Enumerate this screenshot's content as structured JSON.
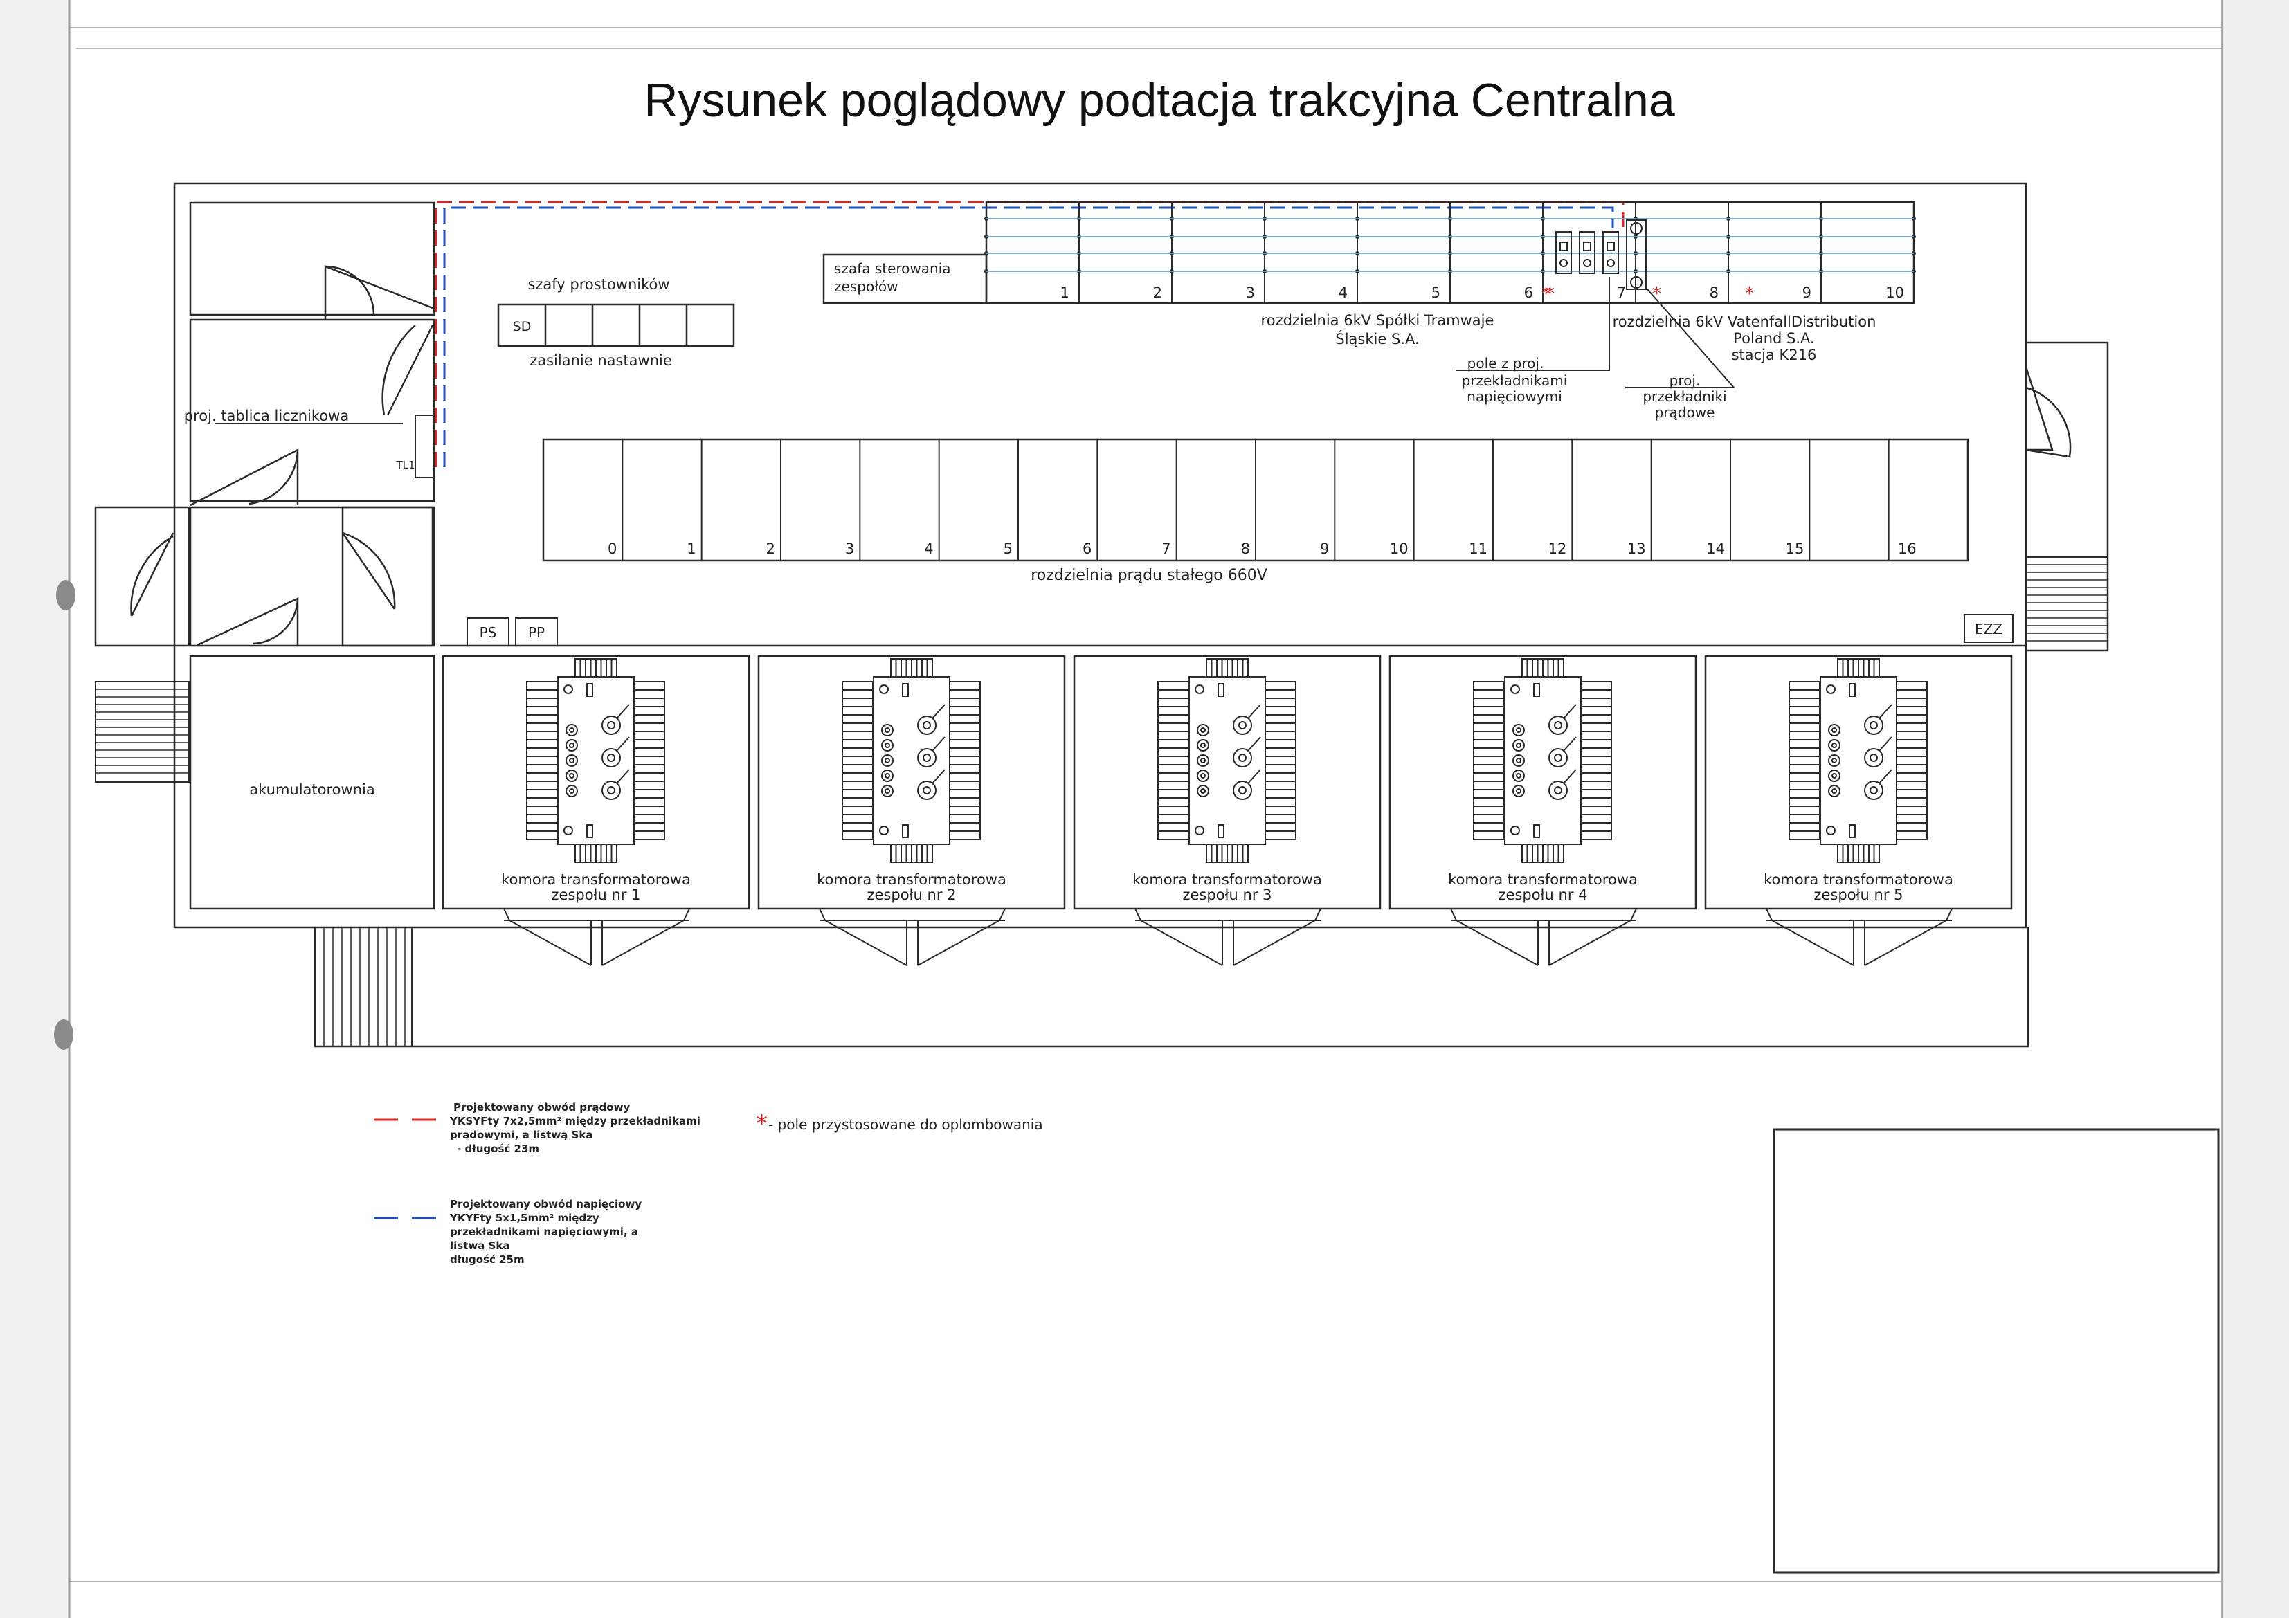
{
  "title": "Rysunek poglądowy podtacja trakcyjna Centralna",
  "labels": {
    "szafy_prostownikow": "szafy prostowników",
    "sd": "SD",
    "zasilanie_nastawnie": "zasilanie nastawnie",
    "tablica_licznikowa": "proj. tablica licznikowa",
    "tl1": "TL1",
    "szafa_sterowania_1": "szafa sterowania",
    "szafa_sterowania_2": "zespołów",
    "rozdzielnia_6kv_tramwaje_1": "rozdzielnia 6kV Spółki Tramwaje",
    "rozdzielnia_6kv_tramwaje_2": "Śląskie S.A.",
    "rozdzielnia_6kv_vattenfall_1": "rozdzielnia 6kV VatenfallDistribution",
    "rozdzielnia_6kv_vattenfall_2": "Poland S.A.",
    "rozdzielnia_6kv_vattenfall_3": "stacja K216",
    "pole_przekladnikami_1": "pole z proj.",
    "pole_przekladnikami_2": "przekładnikami",
    "pole_przekladnikami_3": "napięciowymi",
    "przekladniki_pradowe_1": "proj.",
    "przekladniki_pradowe_2": "przekładniki",
    "przekladniki_pradowe_3": "prądowe",
    "rozdzielnia_pradu_stalego": "rozdzielnia prądu stałego 660V",
    "ps": "PS",
    "pp": "PP",
    "ezz": "EZZ",
    "akumulatorownia": "akumulatorownia"
  },
  "switchgear_6kv_numbers": [
    "1",
    "2",
    "3",
    "4",
    "5",
    "6",
    "7",
    "8",
    "9",
    "10"
  ],
  "switchgear_6kv_sealed_marks": [
    "*",
    "*",
    "*",
    "*"
  ],
  "dc_switchgear_numbers": [
    "0",
    "1",
    "2",
    "3",
    "4",
    "5",
    "6",
    "7",
    "8",
    "9",
    "10",
    "11",
    "12",
    "13",
    "14",
    "15",
    "16"
  ],
  "transformer_chambers": [
    {
      "line1": "komora transformatorowa",
      "line2": "zespołu nr 1"
    },
    {
      "line1": "komora transformatorowa",
      "line2": "zespołu nr 2"
    },
    {
      "line1": "komora transformatorowa",
      "line2": "zespołu nr 3"
    },
    {
      "line1": "komora transformatorowa",
      "line2": "zespołu nr 4"
    },
    {
      "line1": "komora transformatorowa",
      "line2": "zespołu nr 5"
    }
  ],
  "legend": {
    "current_circuit": {
      "color": "#d62828",
      "lines": [
        "Projektowany obwód prądowy",
        "YKSYFty 7x2,5mm² między przekładnikami",
        "prądowymi, a listwą Ska",
        "- długość 23m"
      ]
    },
    "voltage_circuit": {
      "color": "#1f4fb8",
      "lines": [
        "Projektowany obwód napięciowy",
        "YKYFty 5x1,5mm² między",
        "przekładnikami napięciowymi, a",
        "listwą Ska",
        "długość 25m"
      ]
    },
    "sealing": {
      "star": "*",
      "text": "- pole przystosowane do oplombowania"
    }
  },
  "colors": {
    "line": "#2a2a2a",
    "red": "#d62828",
    "blue": "#1f4fb8",
    "teal": "#6aa7c9"
  }
}
